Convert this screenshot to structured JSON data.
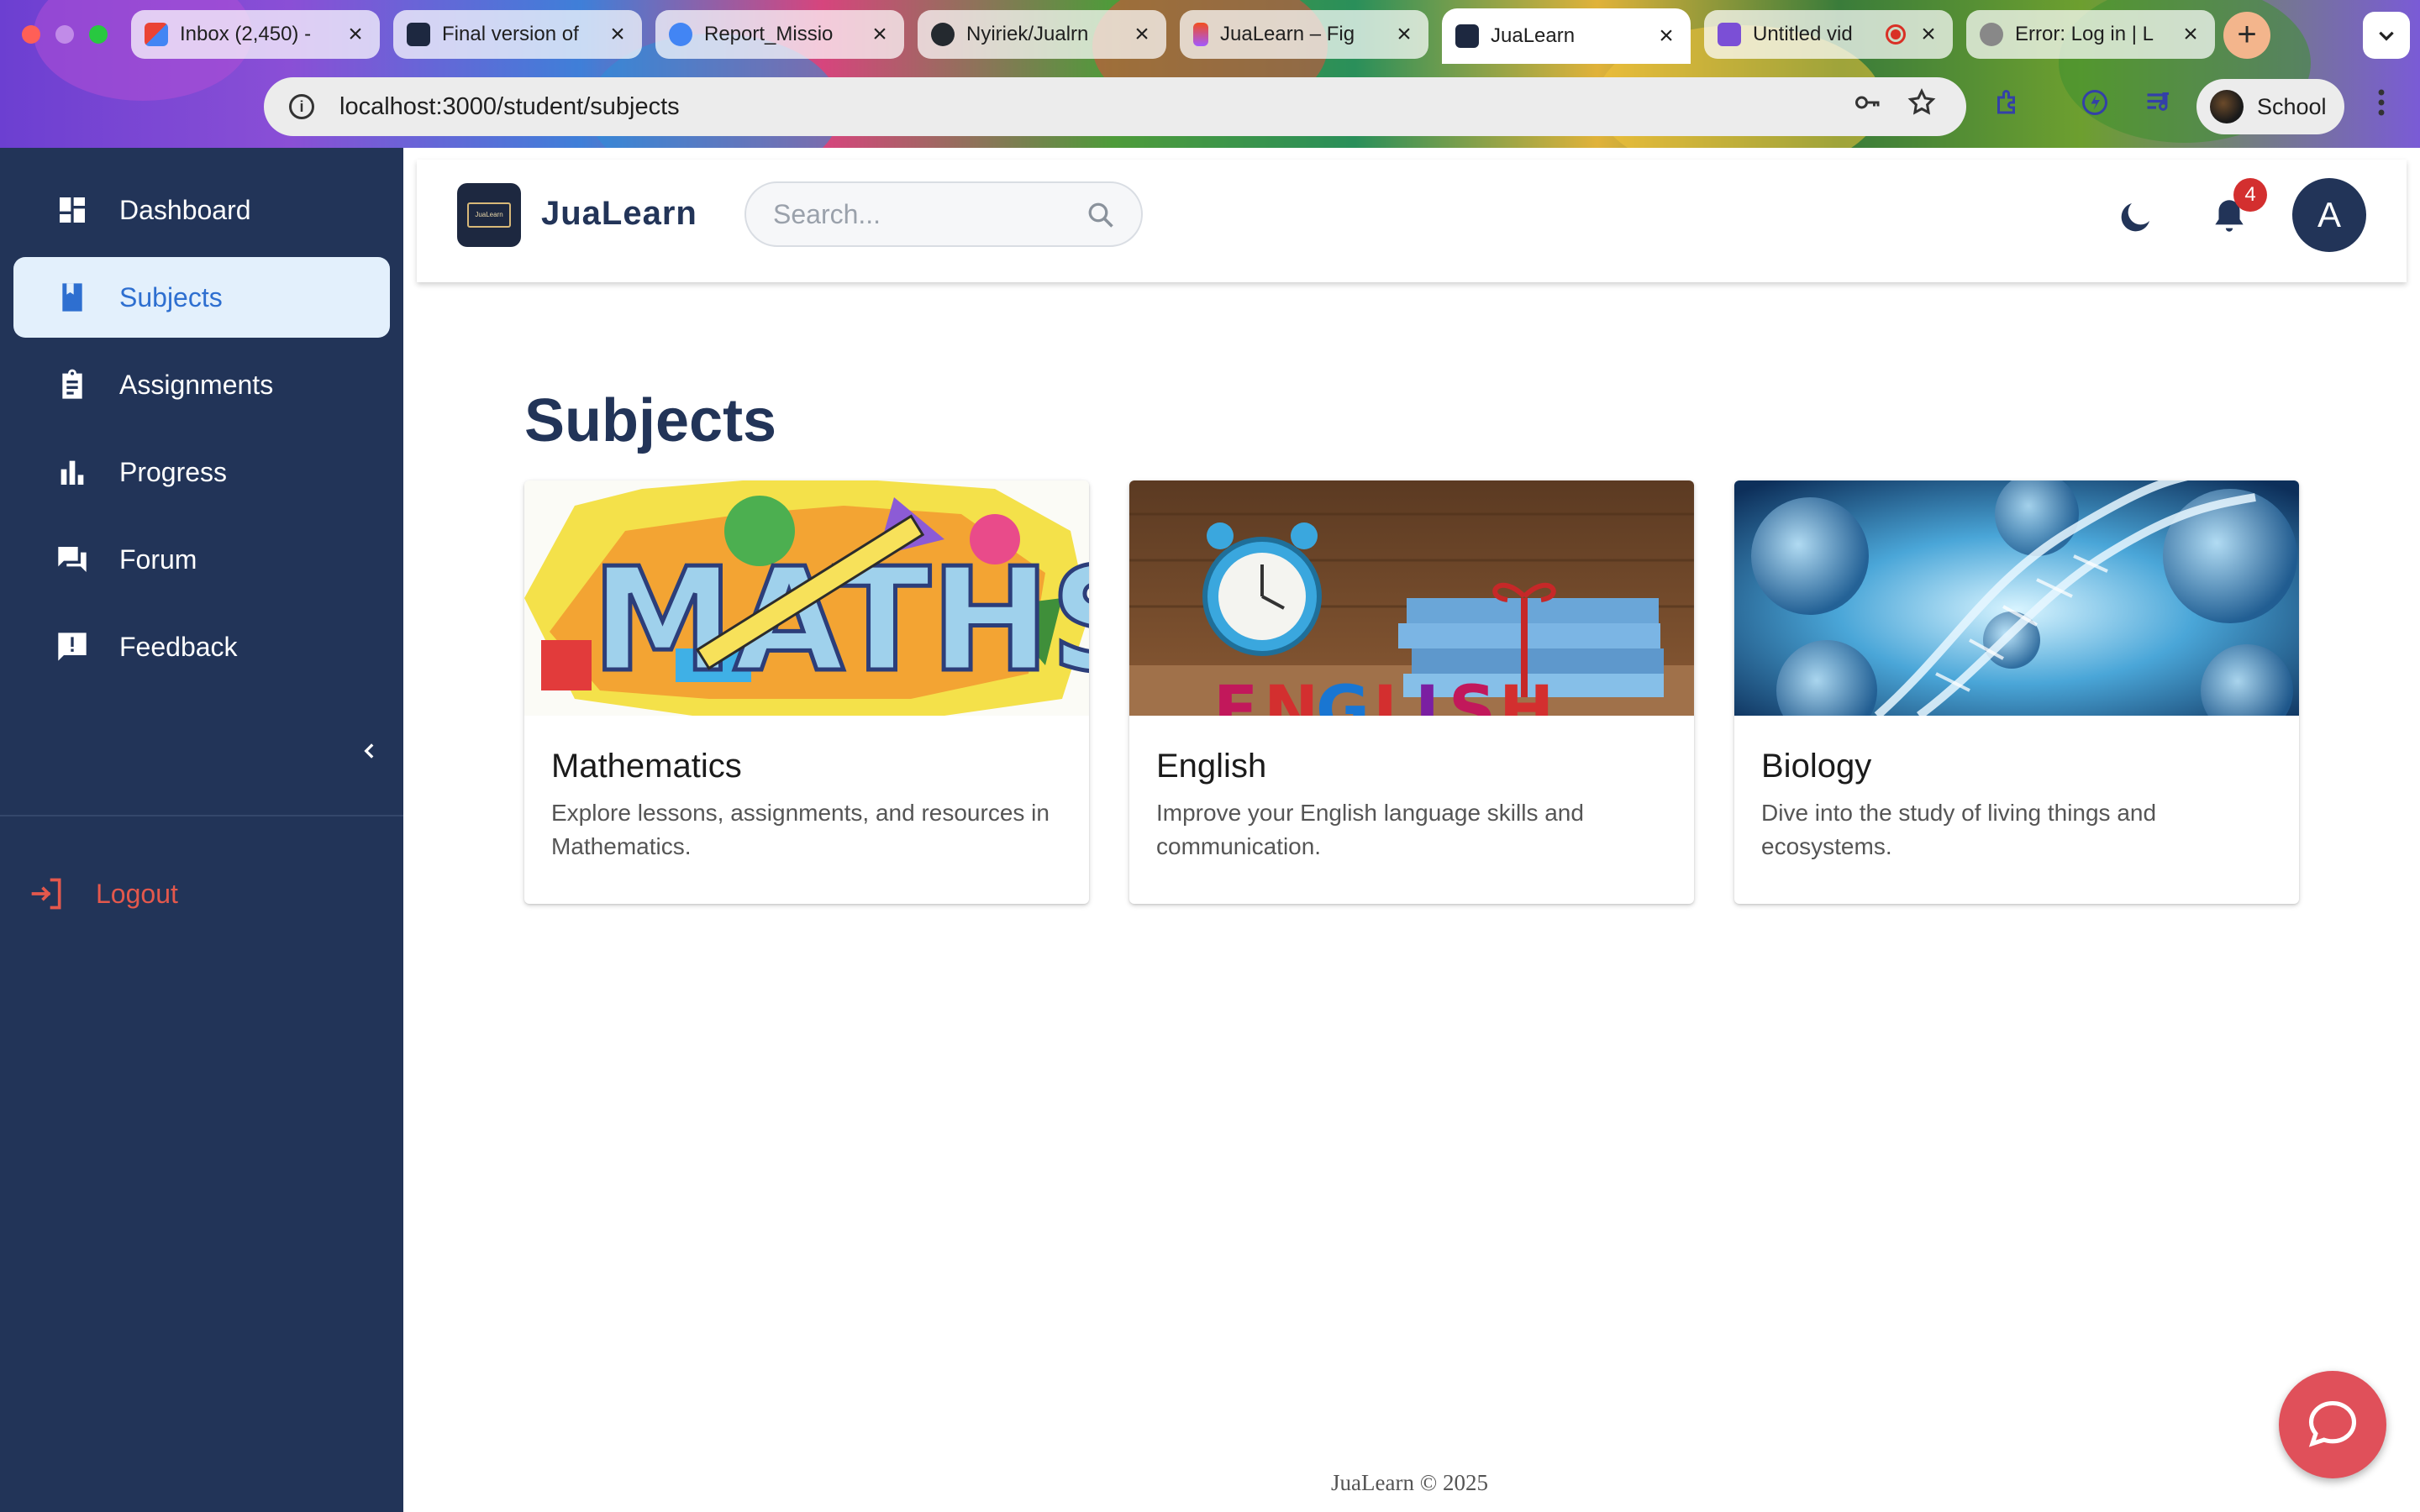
{
  "browser": {
    "tabs": [
      {
        "title": "Inbox (2,450) -",
        "favicon_color": "#ea4335"
      },
      {
        "title": "Final version of",
        "favicon_color": "#1d2840"
      },
      {
        "title": "Report_Missio",
        "favicon_color": "#4285f4"
      },
      {
        "title": "Nyiriek/Jualrn",
        "favicon_color": "#24292f"
      },
      {
        "title": "JuaLearn – Fig",
        "favicon_color": "#f24e1e"
      },
      {
        "title": "JuaLearn",
        "favicon_color": "#1d2840"
      },
      {
        "title": "Untitled vid",
        "favicon_color": "#7b4fd6"
      },
      {
        "title": "Error: Log in | L",
        "favicon_color": "#888888"
      }
    ],
    "active_tab_index": 5,
    "url": "localhost:3000/student/subjects",
    "profile_name": "School"
  },
  "sidebar": {
    "items": [
      {
        "label": "Dashboard",
        "icon": "dashboard-icon",
        "active": false
      },
      {
        "label": "Subjects",
        "icon": "book-icon",
        "active": true
      },
      {
        "label": "Assignments",
        "icon": "clipboard-icon",
        "active": false
      },
      {
        "label": "Progress",
        "icon": "bar-chart-icon",
        "active": false
      },
      {
        "label": "Forum",
        "icon": "forum-icon",
        "active": false
      },
      {
        "label": "Feedback",
        "icon": "feedback-icon",
        "active": false
      }
    ],
    "logout_label": "Logout"
  },
  "header": {
    "brand": "JuaLearn",
    "logo_text": "JuaLearn",
    "search_placeholder": "Search...",
    "notification_count": "4",
    "avatar_initial": "A"
  },
  "main": {
    "title": "Subjects",
    "subjects": [
      {
        "name": "Mathematics",
        "description": "Explore lessons, assignments, and resources in Mathematics."
      },
      {
        "name": "English",
        "description": "Improve your English language skills and communication."
      },
      {
        "name": "Biology",
        "description": "Dive into the study of living things and ecosystems."
      }
    ]
  },
  "footer": {
    "text": "JuaLearn © 2025"
  },
  "colors": {
    "sidebar_bg": "#223458",
    "active_bg": "#e3f0fc",
    "active_text": "#2e6fd0",
    "logout": "#e4584c",
    "chat_fab": "#e0505a",
    "badge": "#d32f2f"
  }
}
